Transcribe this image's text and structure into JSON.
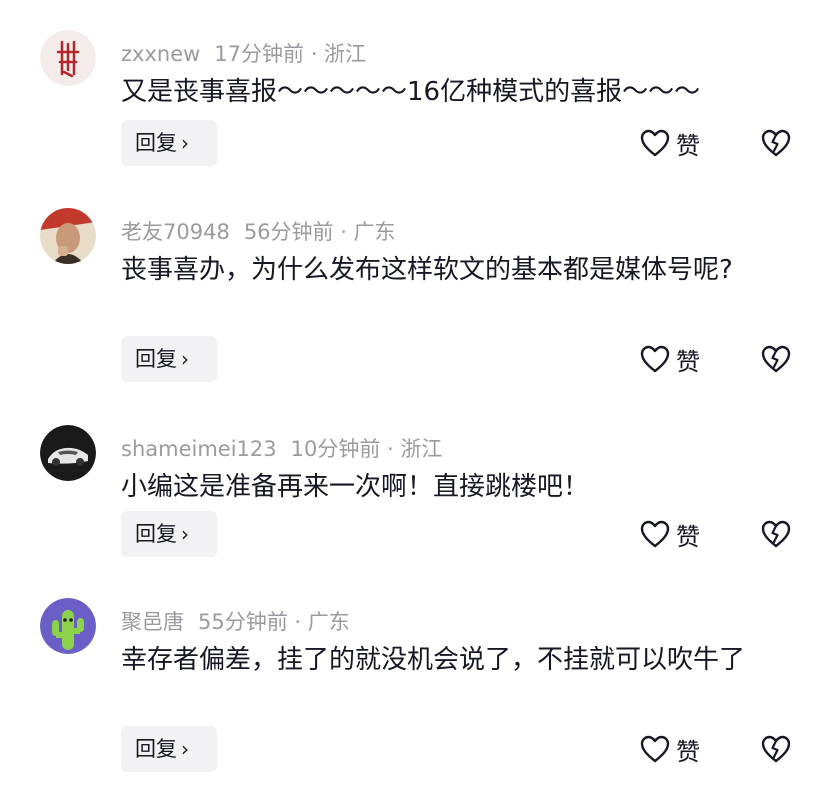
{
  "comments": [
    {
      "username": "zxxnew",
      "time_location": "17分钟前 · 浙江",
      "text": "又是丧事喜报～～～～～16亿种模式的喜报～～～",
      "reply_label": "回复",
      "like_label": "赞"
    },
    {
      "username": "老友70948",
      "time_location": "56分钟前 · 广东",
      "text": "丧事喜办，为什么发布这样软文的基本都是媒体号呢?",
      "reply_label": "回复",
      "like_label": "赞"
    },
    {
      "username": "shameimei123",
      "time_location": "10分钟前 · 浙江",
      "text": "小编这是准备再来一次啊！直接跳楼吧！",
      "reply_label": "回复",
      "like_label": "赞"
    },
    {
      "username": "聚邑唐",
      "time_location": "55分钟前 · 广东",
      "text": "幸存者偏差，挂了的就没机会说了，不挂就可以吹牛了",
      "reply_label": "回复",
      "like_label": "赞"
    }
  ],
  "icons": {
    "reply_chevron": "chevron-right-icon",
    "like": "heart-outline-icon",
    "dislike": "broken-heart-icon"
  },
  "colors": {
    "meta_text": "#9a9ba1",
    "body_text": "#161823",
    "reply_button_bg": "#f2f2f4"
  }
}
